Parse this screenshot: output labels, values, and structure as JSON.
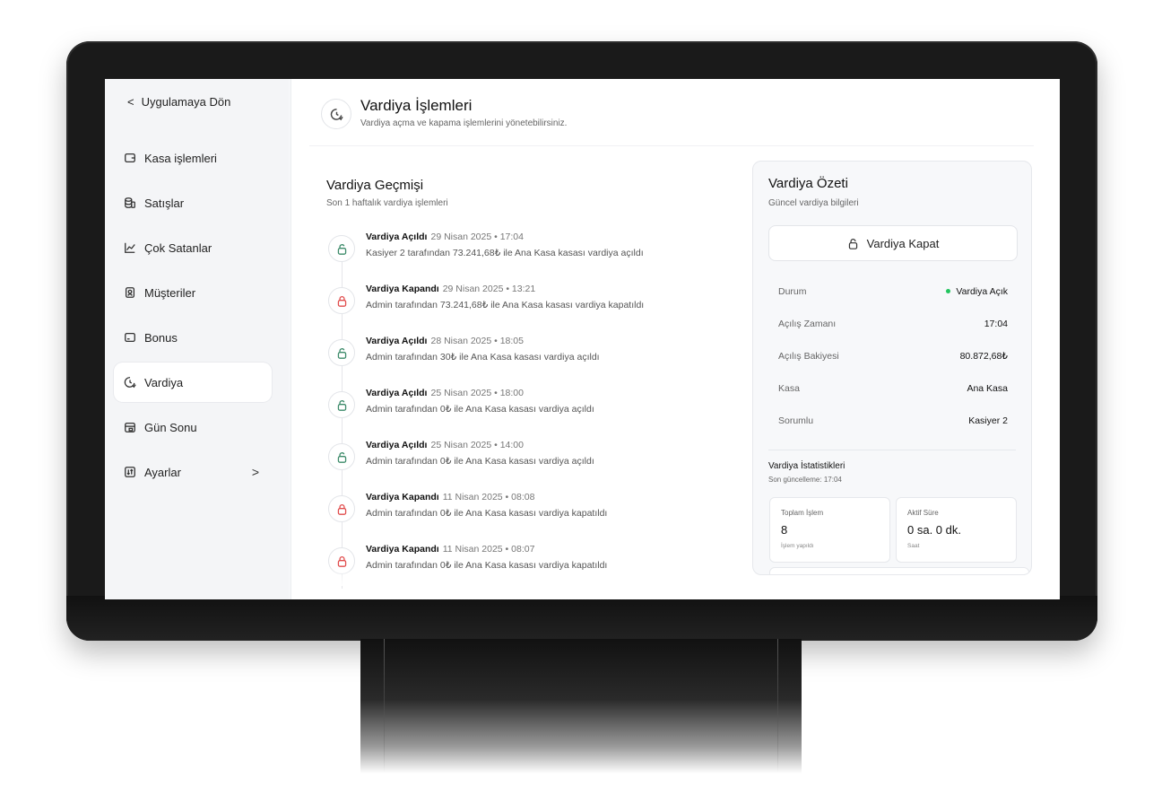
{
  "sidebar": {
    "back_label": "Uygulamaya Dön",
    "items": [
      {
        "label": "Kasa işlemleri",
        "icon": "wallet-icon"
      },
      {
        "label": "Satışlar",
        "icon": "coins-icon"
      },
      {
        "label": "Çok Satanlar",
        "icon": "chart-line-icon"
      },
      {
        "label": "Müşteriler",
        "icon": "contact-icon"
      },
      {
        "label": "Bonus",
        "icon": "card-icon"
      },
      {
        "label": "Vardiya",
        "icon": "clock-icon",
        "active": true
      },
      {
        "label": "Gün Sonu",
        "icon": "calendar-lock-icon"
      },
      {
        "label": "Ayarlar",
        "icon": "sort-icon",
        "chevron": ">"
      }
    ]
  },
  "header": {
    "title": "Vardiya İşlemleri",
    "subtitle": "Vardiya açma ve kapama işlemlerini yönetebilirsiniz."
  },
  "history": {
    "title": "Vardiya Geçmişi",
    "subtitle": "Son 1 haftalık vardiya işlemleri",
    "events": [
      {
        "status": "open",
        "title": "Vardiya Açıldı",
        "time": "29 Nisan 2025 • 17:04",
        "desc": "Kasiyer 2 tarafından 73.241,68₺ ile Ana Kasa kasası vardiya açıldı"
      },
      {
        "status": "closed",
        "title": "Vardiya Kapandı",
        "time": "29 Nisan 2025 • 13:21",
        "desc": "Admin tarafından 73.241,68₺ ile Ana Kasa kasası vardiya kapatıldı"
      },
      {
        "status": "open",
        "title": "Vardiya Açıldı",
        "time": "28 Nisan 2025 • 18:05",
        "desc": "Admin tarafından 30₺ ile Ana Kasa kasası vardiya açıldı"
      },
      {
        "status": "open",
        "title": "Vardiya Açıldı",
        "time": "25 Nisan 2025 • 18:00",
        "desc": "Admin tarafından 0₺ ile Ana Kasa kasası vardiya açıldı"
      },
      {
        "status": "open",
        "title": "Vardiya Açıldı",
        "time": "25 Nisan 2025 • 14:00",
        "desc": "Admin tarafından 0₺ ile Ana Kasa kasası vardiya açıldı"
      },
      {
        "status": "closed",
        "title": "Vardiya Kapandı",
        "time": "11 Nisan 2025 • 08:08",
        "desc": "Admin tarafından 0₺ ile Ana Kasa kasası vardiya kapatıldı"
      },
      {
        "status": "closed",
        "title": "Vardiya Kapandı",
        "time": "11 Nisan 2025 • 08:07",
        "desc": "Admin tarafından 0₺ ile Ana Kasa kasası vardiya kapatıldı"
      }
    ]
  },
  "summary": {
    "title": "Vardiya Özeti",
    "subtitle": "Güncel vardiya bilgileri",
    "close_button": "Vardiya Kapat",
    "rows": [
      {
        "key": "Durum",
        "value": "Vardiya Açık",
        "dot": true
      },
      {
        "key": "Açılış Zamanı",
        "value": "17:04"
      },
      {
        "key": "Açılış Bakiyesi",
        "value": "80.872,68₺"
      },
      {
        "key": "Kasa",
        "value": "Ana Kasa"
      },
      {
        "key": "Sorumlu",
        "value": "Kasiyer 2"
      }
    ],
    "stats_title": "Vardiya İstatistikleri",
    "stats_sub": "Son güncelleme: 17:04",
    "stats": [
      {
        "label": "Toplam İşlem",
        "value": "8",
        "note": "İşlem yapıldı"
      },
      {
        "label": "Aktif Süre",
        "value": "0 sa. 0 dk.",
        "note": "Saat"
      }
    ],
    "status_color": "#22c55e"
  }
}
